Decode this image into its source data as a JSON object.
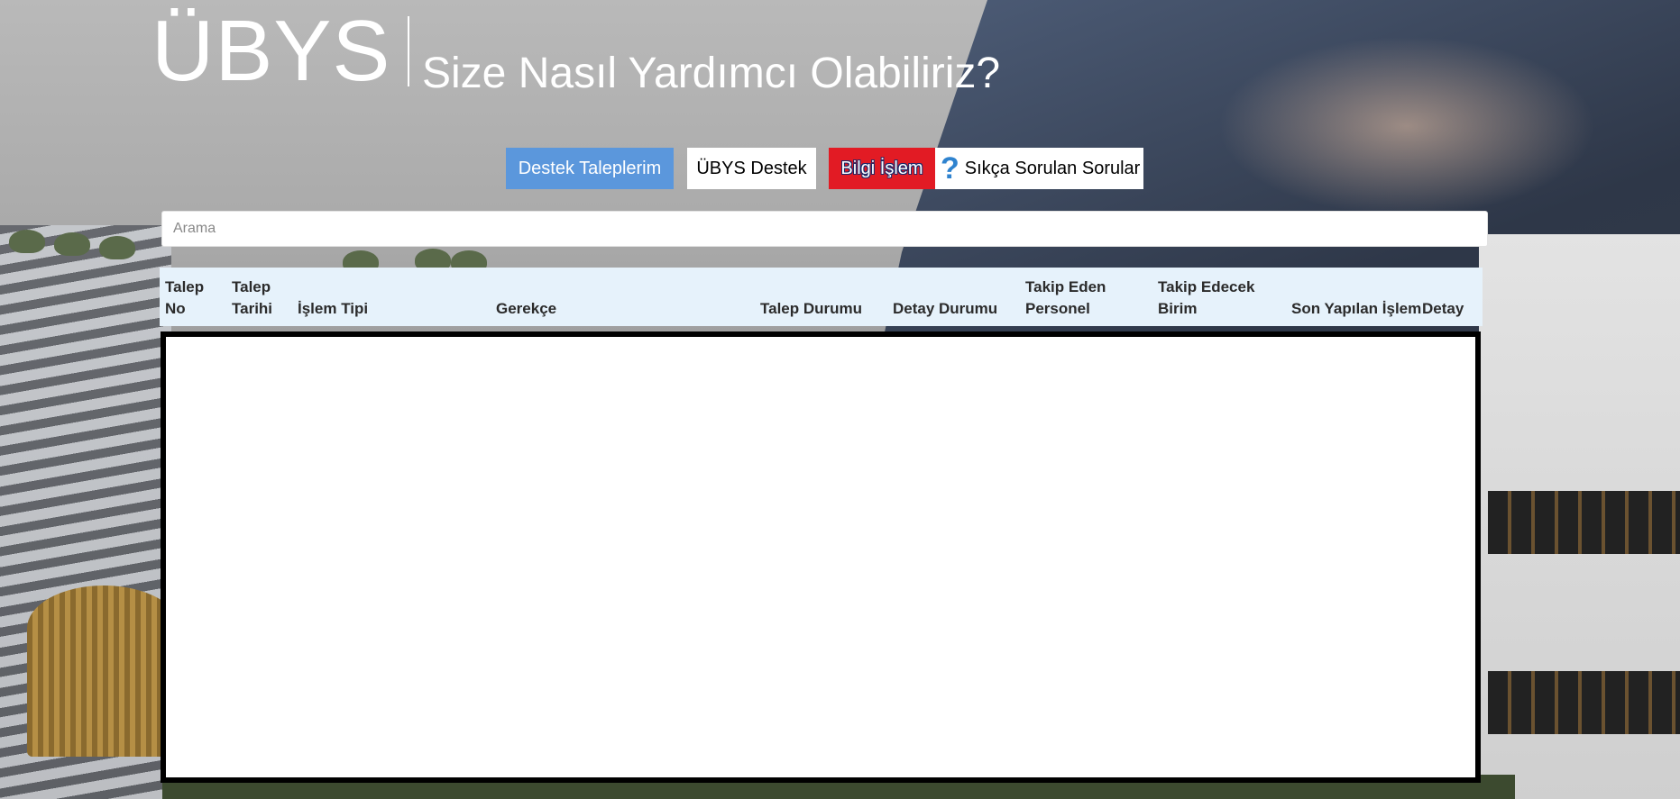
{
  "header": {
    "brand": "ÜBYS",
    "tagline": "Size Nasıl Yardımcı Olabiliriz?"
  },
  "nav": {
    "destek_talepleri": "Destek Taleplerim",
    "ubys_destek": "ÜBYS Destek",
    "bilgi_islem": "Bilgi İşlem",
    "sss": "Sıkça Sorulan Sorular",
    "sss_icon": "question-mark-icon"
  },
  "search": {
    "placeholder": "Arama",
    "value": ""
  },
  "table": {
    "columns": [
      {
        "line1": "Talep",
        "line2": "No"
      },
      {
        "line1": "Talep",
        "line2": "Tarihi"
      },
      {
        "line1": "",
        "line2": "İşlem Tipi"
      },
      {
        "line1": "",
        "line2": "Gerekçe"
      },
      {
        "line1": "",
        "line2": "Talep Durumu"
      },
      {
        "line1": "",
        "line2": "Detay Durumu"
      },
      {
        "line1": "Takip Eden",
        "line2": "Personel"
      },
      {
        "line1": "Takip Edecek",
        "line2": "Birim"
      },
      {
        "line1": "",
        "line2": "Son Yapılan İşlem"
      },
      {
        "line1": "",
        "line2": "Detay"
      }
    ],
    "rows": []
  },
  "colors": {
    "primary_button": "#5b97dc",
    "danger_button": "#e21b24",
    "table_header_bg": "#e6f2fb",
    "help_icon": "#2f83cf"
  }
}
